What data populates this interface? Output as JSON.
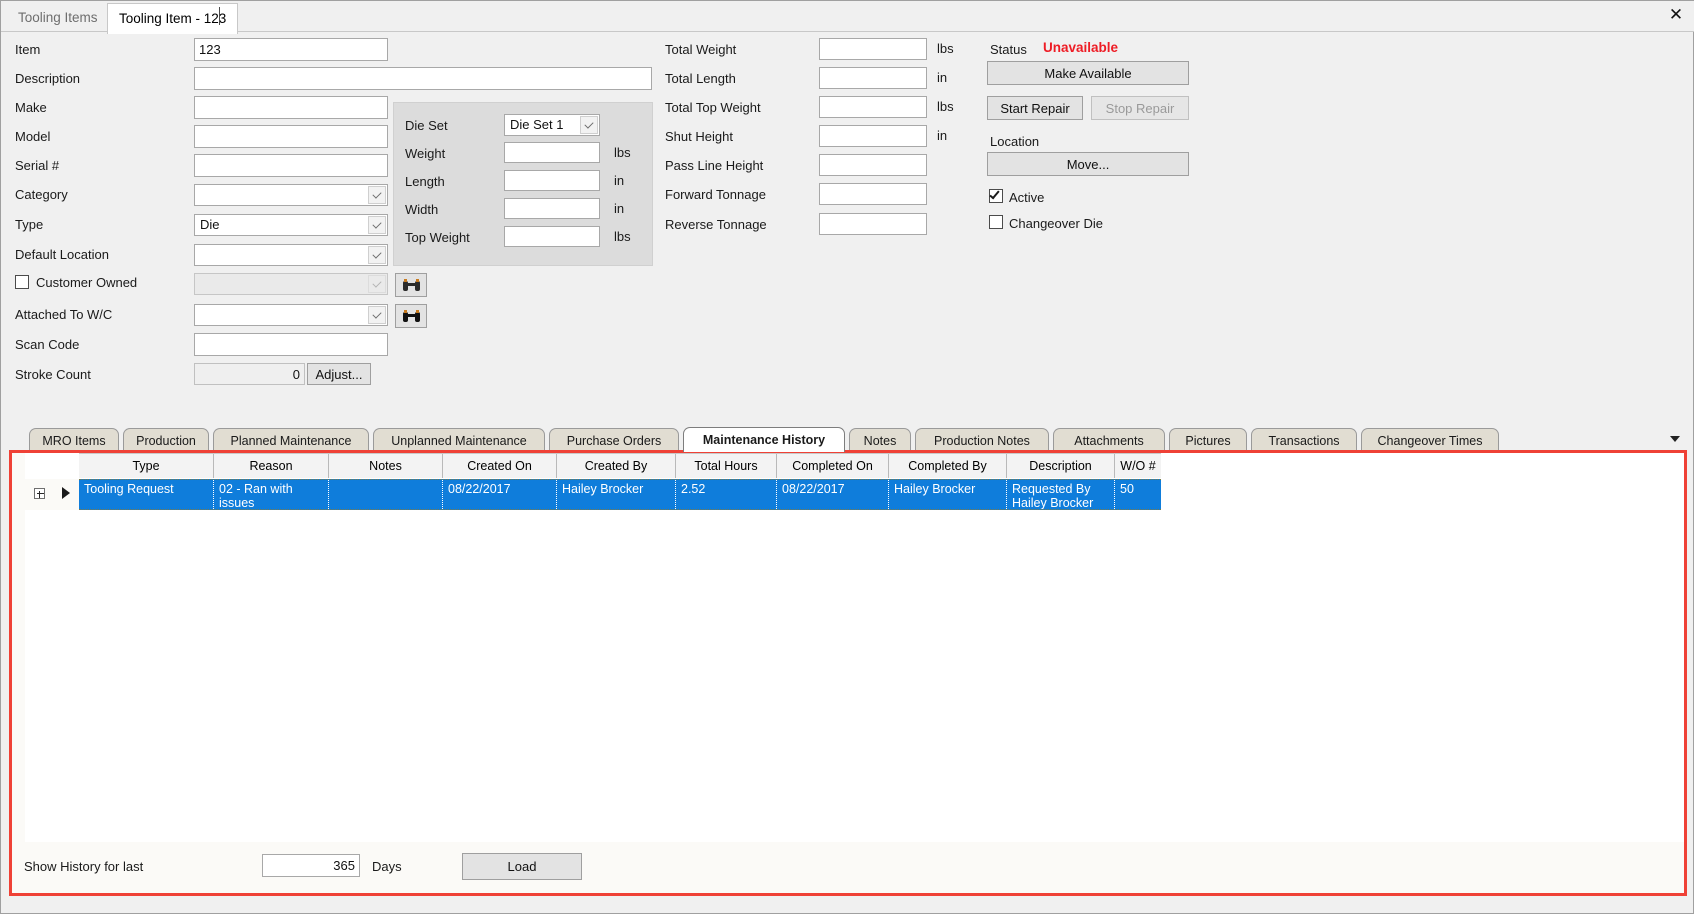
{
  "window": {
    "doc_tab_inactive": "Tooling Items",
    "doc_tab_active": "Tooling Item - 123",
    "close_icon": "close-icon"
  },
  "left_form": {
    "fields": [
      {
        "label": "Item",
        "value": "123",
        "kind": "text"
      },
      {
        "label": "Description",
        "value": "",
        "kind": "text"
      },
      {
        "label": "Make",
        "value": "",
        "kind": "text"
      },
      {
        "label": "Model",
        "value": "",
        "kind": "text"
      },
      {
        "label": "Serial #",
        "value": "",
        "kind": "text"
      },
      {
        "label": "Category",
        "value": "",
        "kind": "combo"
      },
      {
        "label": "Type",
        "value": "Die",
        "kind": "combo"
      },
      {
        "label": "Default Location",
        "value": "",
        "kind": "combo"
      },
      {
        "label": "Customer Owned",
        "value": "",
        "kind": "checkbox-combo"
      },
      {
        "label": "Attached To W/C",
        "value": "",
        "kind": "combo"
      },
      {
        "label": "Scan Code",
        "value": "",
        "kind": "text"
      },
      {
        "label": "Stroke Count",
        "value": "0",
        "kind": "readonly-num"
      }
    ],
    "customer_owned_checked": false,
    "adjust_button": "Adjust...",
    "find_icon": "binoculars-icon"
  },
  "die_set_panel": {
    "rows": [
      {
        "label": "Die Set",
        "value": "Die Set 1",
        "unit": "",
        "kind": "combo"
      },
      {
        "label": "Weight",
        "value": "",
        "unit": "lbs",
        "kind": "text"
      },
      {
        "label": "Length",
        "value": "",
        "unit": "in",
        "kind": "text"
      },
      {
        "label": "Width",
        "value": "",
        "unit": "in",
        "kind": "text"
      },
      {
        "label": "Top Weight",
        "value": "",
        "unit": "lbs",
        "kind": "text"
      }
    ]
  },
  "measurements": {
    "rows": [
      {
        "label": "Total Weight",
        "value": "",
        "unit": "lbs"
      },
      {
        "label": "Total Length",
        "value": "",
        "unit": "in"
      },
      {
        "label": "Total Top Weight",
        "value": "",
        "unit": "lbs"
      },
      {
        "label": "Shut Height",
        "value": "",
        "unit": "in"
      },
      {
        "label": "Pass Line Height",
        "value": "",
        "unit": ""
      },
      {
        "label": "Forward Tonnage",
        "value": "",
        "unit": ""
      },
      {
        "label": "Reverse Tonnage",
        "value": "",
        "unit": ""
      }
    ]
  },
  "status_panel": {
    "status_label": "Status",
    "status_value": "Unavailable",
    "status_color": "#ee1c25",
    "make_available_button": "Make Available",
    "start_repair_button": "Start Repair",
    "stop_repair_button": "Stop Repair",
    "stop_repair_disabled": true,
    "location_label": "Location",
    "move_button": "Move...",
    "active_label": "Active",
    "active_checked": true,
    "changeover_label": "Changeover Die",
    "changeover_checked": false
  },
  "tabs": {
    "items": [
      "MRO Items",
      "Production",
      "Planned Maintenance",
      "Unplanned Maintenance",
      "Purchase Orders",
      "Maintenance History",
      "Notes",
      "Production Notes",
      "Attachments",
      "Pictures",
      "Transactions",
      "Changeover Times"
    ],
    "selected_index": 5,
    "overflow_icon": "chevron-down-icon"
  },
  "grid": {
    "columns": [
      "Type",
      "Reason",
      "Notes",
      "Created On",
      "Created By",
      "Total Hours",
      "Completed On",
      "Completed By",
      "Description",
      "W/O #"
    ],
    "rows": [
      {
        "type": "Tooling Request",
        "reason": "02 - Ran with issues",
        "notes": "",
        "created_on": "08/22/2017",
        "created_by": "Hailey Brocker",
        "total_hours": "2.52",
        "completed_on": "08/22/2017",
        "completed_by": "Hailey Brocker",
        "description": "Requested By Hailey Brocker",
        "wo_number": "50",
        "selected": true
      }
    ],
    "expander_icon": "plus-expander-icon",
    "row_indicator_icon": "current-row-arrow-icon"
  },
  "grid_footer": {
    "show_history_label": "Show History for last",
    "days_value": "365",
    "days_label": "Days",
    "load_button": "Load"
  }
}
